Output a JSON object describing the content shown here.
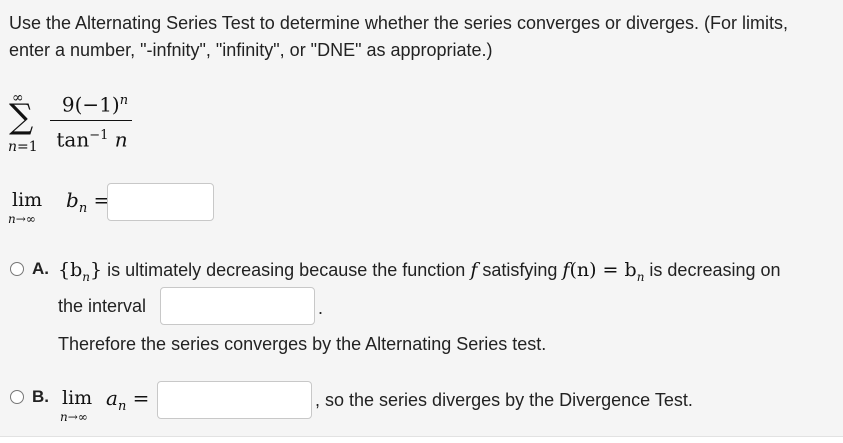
{
  "instructions": "Use the Alternating Series Test to determine whether the series converges or diverges. (For limits, enter a number, \"-infnity\", \"infinity\", or \"DNE\" as appropriate.)",
  "series": {
    "upper": "∞",
    "sigma": "∑",
    "lower_var": "n",
    "lower_eq": "=1",
    "numerator": "9(−1)",
    "numerator_exp": "n",
    "denominator": "tan",
    "denominator_exp": "−1",
    "denominator_var": "n"
  },
  "limit": {
    "lim": "lim",
    "sub": "n→∞",
    "expr": "b",
    "expr_sub": "n",
    "equals": "=",
    "value": ""
  },
  "option_a": {
    "letter": "A.",
    "text_1": "{b",
    "text_1_sub": "n",
    "text_1_end": "}",
    "text_2": " is ultimately decreasing because the function ",
    "f": "f",
    "text_3": " satisfying ",
    "fn": "f",
    "fn_arg": "(n) = b",
    "fn_sub": "n",
    "text_4": " is decreasing on",
    "line2": "the interval",
    "line2_end": ".",
    "interval_value": "",
    "line3": "Therefore the series converges by the Alternating Series test."
  },
  "option_b": {
    "letter": "B.",
    "lim": "lim",
    "sub": "n→∞",
    "expr": "a",
    "expr_sub": "n",
    "equals": "=",
    "value": "",
    "tail": ", so the series diverges by the Divergence Test."
  }
}
